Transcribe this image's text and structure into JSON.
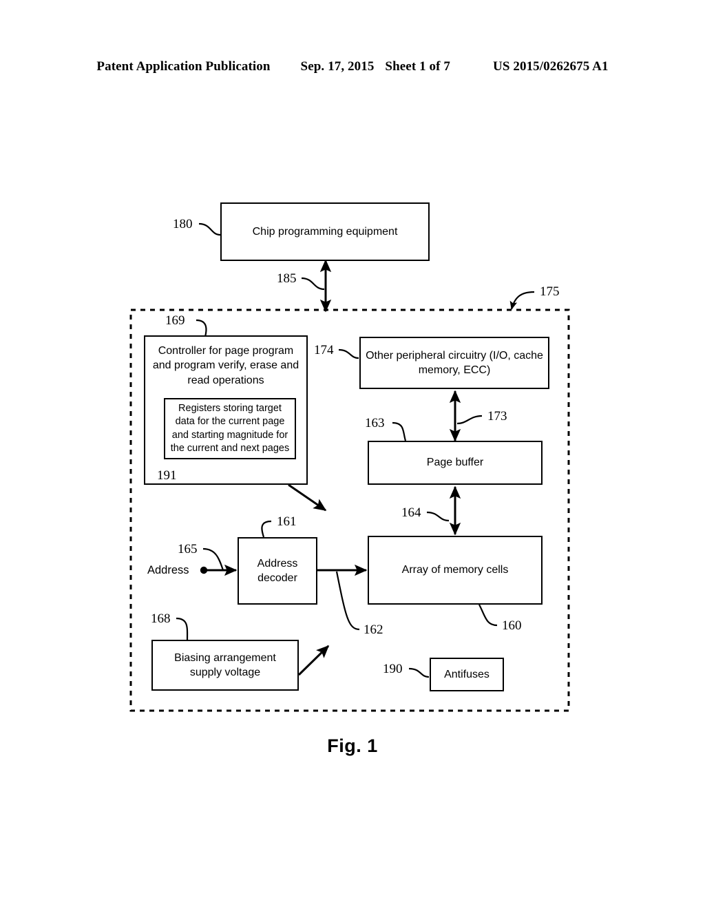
{
  "header": {
    "left": "Patent Application Publication",
    "date": "Sep. 17, 2015",
    "sheet": "Sheet 1 of 7",
    "number": "US 2015/0262675 A1"
  },
  "figure": {
    "caption": "Fig. 1",
    "boxes": {
      "chip_programming_equipment": "Chip programming equipment",
      "controller": "Controller for page program and program verify, erase and read operations",
      "registers": "Registers storing target data for the current page and starting magnitude for the current and next pages",
      "other_peripheral_circuitry": "Other peripheral circuitry (I/O, cache memory, ECC)",
      "page_buffer": "Page buffer",
      "address_decoder": "Address decoder",
      "array_of_memory_cells": "Array of memory cells",
      "biasing_arrangement": "Biasing arrangement supply voltage",
      "antifuses": "Antifuses"
    },
    "signals": {
      "address": "Address"
    },
    "refs": {
      "chip_programming_equipment": "180",
      "link_equipment_to_device": "185",
      "integrated_circuit": "175",
      "controller": "169",
      "registers": "191",
      "controller_to_peripheral": "174",
      "peripheral_to_page_buffer": "173",
      "page_buffer": "163",
      "page_buffer_to_array": "164",
      "address_decoder": "161",
      "address_input": "165",
      "decoder_to_array": "162",
      "array_of_memory_cells": "160",
      "biasing_arrangement": "168",
      "antifuses": "190"
    }
  }
}
